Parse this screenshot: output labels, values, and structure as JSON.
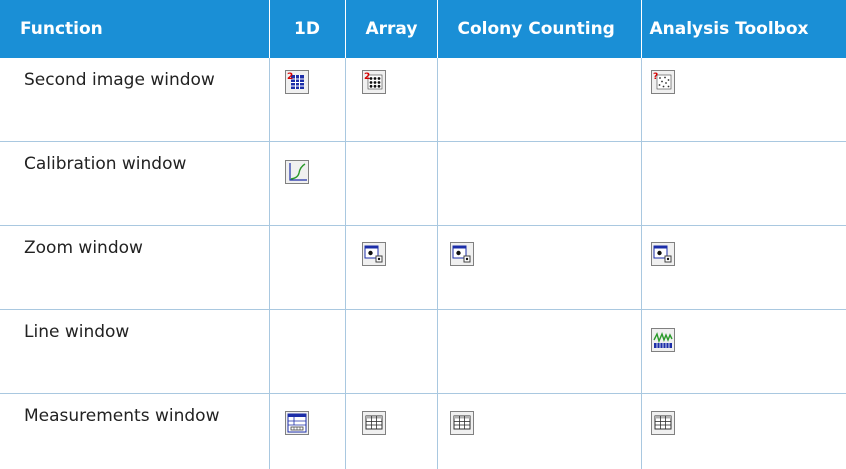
{
  "header": {
    "function": "Function",
    "col_1d": "1D",
    "col_array": "Array",
    "col_colony": "Colony Counting",
    "col_toolbox": "Analysis Toolbox"
  },
  "rows": [
    {
      "label": "Second image window",
      "icons": [
        "second-image-1d",
        "second-image-array",
        null,
        "second-image-toolbox"
      ]
    },
    {
      "label": "Calibration window",
      "icons": [
        "calibration",
        null,
        null,
        null
      ]
    },
    {
      "label": "Zoom window",
      "icons": [
        null,
        "zoom",
        "zoom",
        "zoom"
      ]
    },
    {
      "label": "Line window",
      "icons": [
        null,
        null,
        null,
        "line"
      ]
    },
    {
      "label": "Measurements window",
      "icons": [
        "measurements-1d",
        "measurements",
        "measurements",
        "measurements"
      ]
    }
  ],
  "colors": {
    "header_bg": "#1a8fd6",
    "grid": "#a9c8e0"
  }
}
